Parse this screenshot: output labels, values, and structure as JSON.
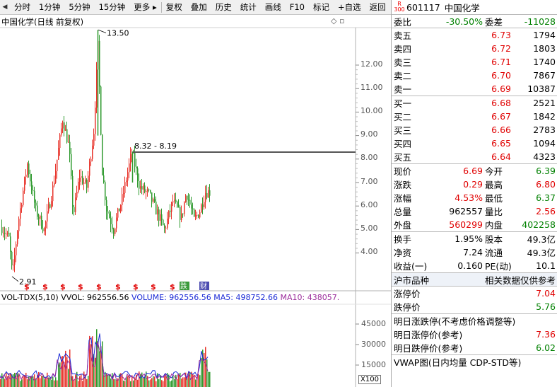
{
  "toolbar": {
    "items": [
      "分时",
      "1分钟",
      "5分钟",
      "15分钟",
      "更多 ▸",
      "复权",
      "叠加",
      "历史",
      "统计",
      "画线",
      "F10",
      "标记",
      "+自选",
      "返回"
    ]
  },
  "chart": {
    "title": "中国化学(日线 前复权)",
    "icons": "◇ ▫",
    "y_ticks": [
      "12.00",
      "11.00",
      "10.00",
      "9.00",
      "8.00",
      "7.00",
      "6.00",
      "5.00",
      "4.00"
    ],
    "high_label": "13.50",
    "low_label": "2.91",
    "range_label": "8.32 - 8.19",
    "event_markers": [
      "$",
      "$",
      "$",
      "$",
      "$",
      "$",
      "$",
      "$",
      "$",
      "$"
    ],
    "special_markers": [
      "跌",
      "财"
    ]
  },
  "volume": {
    "header": {
      "name": "VOL-TDX(5,10)",
      "vvol": "VVOL: 962556.56",
      "volume": "VOLUME: 962556.56",
      "ma5": "MA5: 498752.66",
      "ma10": "MA10: 438057."
    },
    "ticks": [
      "45000",
      "30000",
      "15000"
    ],
    "unit": "X100"
  },
  "quote": {
    "code": "601117",
    "name": "中国化学",
    "flag_top": "R",
    "flag_bottom": "300",
    "weibi_label": "委比",
    "weibi": "-30.50%",
    "weicha_label": "委差",
    "weicha": "-11028",
    "asks": [
      {
        "label": "卖五",
        "price": "6.73",
        "vol": "1794"
      },
      {
        "label": "卖四",
        "price": "6.72",
        "vol": "1803"
      },
      {
        "label": "卖三",
        "price": "6.71",
        "vol": "1740"
      },
      {
        "label": "卖二",
        "price": "6.70",
        "vol": "7867"
      },
      {
        "label": "卖一",
        "price": "6.69",
        "vol": "10387"
      }
    ],
    "bids": [
      {
        "label": "买一",
        "price": "6.68",
        "vol": "2521"
      },
      {
        "label": "买二",
        "price": "6.67",
        "vol": "1842"
      },
      {
        "label": "买三",
        "price": "6.66",
        "vol": "2783"
      },
      {
        "label": "买四",
        "price": "6.65",
        "vol": "1094"
      },
      {
        "label": "买五",
        "price": "6.64",
        "vol": "4323"
      }
    ],
    "stats1": [
      {
        "l1": "现价",
        "v1": "6.69",
        "l2": "今开",
        "v2": "6.39"
      },
      {
        "l1": "涨跌",
        "v1": "0.29",
        "l2": "最高",
        "v2": "6.80"
      },
      {
        "l1": "涨幅",
        "v1": "4.53%",
        "l2": "最低",
        "v2": "6.37"
      },
      {
        "l1": "总量",
        "v1": "962557",
        "l2": "量比",
        "v2": "2.56"
      },
      {
        "l1": "外盘",
        "v1": "560299",
        "l2": "内盘",
        "v2": "402258"
      }
    ],
    "stats2": [
      {
        "l1": "换手",
        "v1": "1.95%",
        "l2": "股本",
        "v2": "49.3亿"
      },
      {
        "l1": "净资",
        "v1": "7.24",
        "l2": "流通",
        "v2": "49.3亿"
      },
      {
        "l1": "收益(一)",
        "v1": "0.160",
        "l2": "PE(动)",
        "v2": "10.1"
      }
    ],
    "section_left": "沪市品种",
    "section_right": "相关数据仅供参考",
    "limits": [
      {
        "label": "涨停价",
        "value": "7.04"
      },
      {
        "label": "跌停价",
        "value": "5.76"
      }
    ],
    "next_title": "明日涨跌停(不考虑价格调整等)",
    "next": [
      {
        "label": "明日涨停价(参考)",
        "value": "7.36"
      },
      {
        "label": "明日跌停价(参考)",
        "value": "6.02"
      }
    ],
    "vwap": "VWAP图(日内均量 CDP-STD等)"
  },
  "colors": {
    "up": "#e00000",
    "down": "#008000",
    "up_candle": "#e8352c",
    "down_candle": "#2e9a2e",
    "vol_blue": "#1a2ad6",
    "vol_purple": "#9b2c9b",
    "vol_green": "#2e9a2e"
  }
}
